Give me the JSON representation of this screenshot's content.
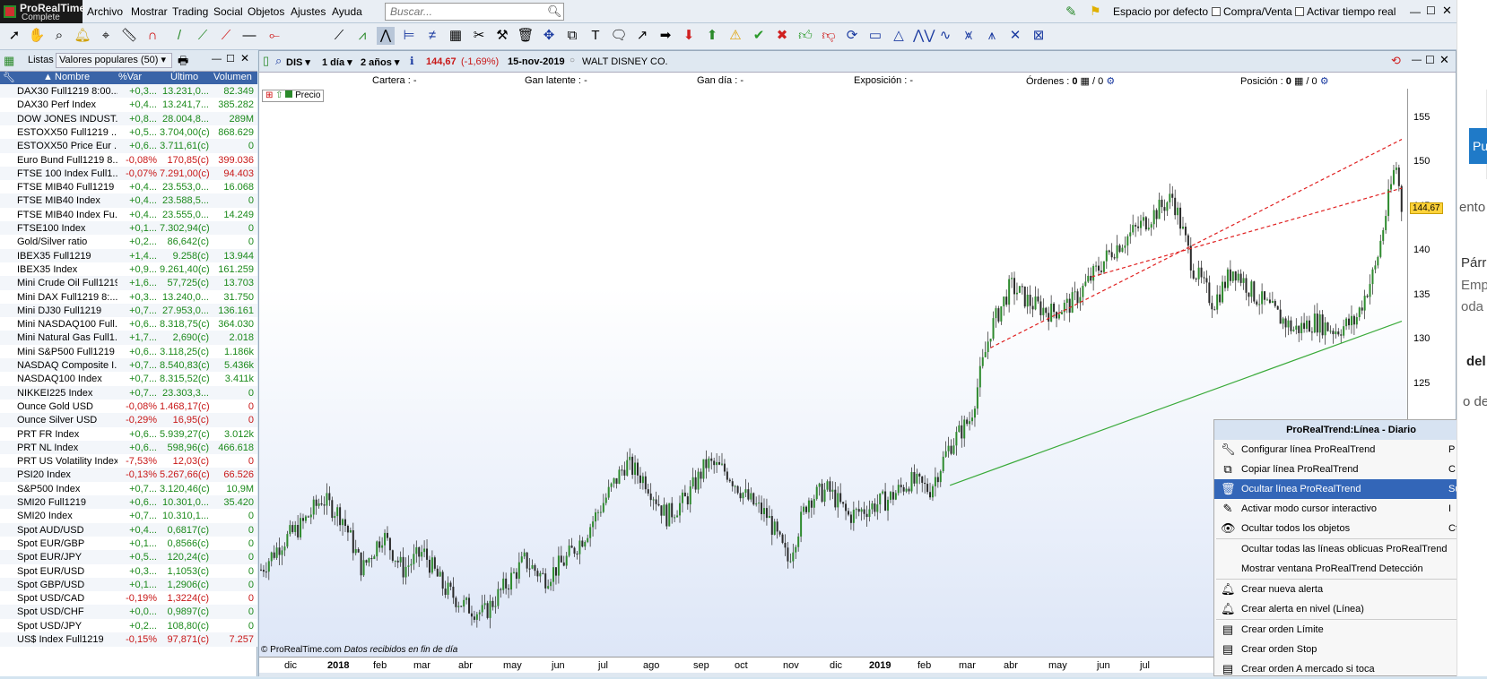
{
  "app": {
    "logo_line1": "ProRealTime",
    "logo_line2": "Complete"
  },
  "menu": [
    "Archivo",
    "Mostrar",
    "Trading",
    "Social",
    "Objetos",
    "Ajustes",
    "Ayuda"
  ],
  "search": {
    "placeholder": "Buscar..."
  },
  "top_right": {
    "workspace": "Espacio por defecto",
    "buy_sell": "Compra/Venta",
    "realtime": "Activar tiempo real"
  },
  "left_panel": {
    "lists_label": "Listas",
    "list_name": "Valores populares (50)",
    "columns": [
      "Nombre",
      "%Var",
      "Último",
      "Volumen"
    ],
    "rows": [
      [
        "DAX30 Full1219 8:00...",
        "+0,3...",
        "13.231,0...",
        "82.349"
      ],
      [
        "DAX30 Perf Index",
        "+0,4...",
        "13.241,7...",
        "385.282"
      ],
      [
        "DOW JONES INDUST...",
        "+0,8...",
        "28.004,8...",
        "289M"
      ],
      [
        "ESTOXX50 Full1219 ...",
        "+0,5...",
        "3.704,00(c)",
        "868.629"
      ],
      [
        "ESTOXX50 Price Eur ...",
        "+0,6...",
        "3.711,61(c)",
        "0"
      ],
      [
        "Euro Bund Full1219 8...",
        "-0,08%",
        "170,85(c)",
        "399.036"
      ],
      [
        "FTSE 100 Index Full1...",
        "-0,07%",
        "7.291,00(c)",
        "94.403"
      ],
      [
        "FTSE MIB40 Full1219",
        "+0,4...",
        "23.553,0...",
        "16.068"
      ],
      [
        "FTSE MIB40 Index",
        "+0,4...",
        "23.588,5...",
        "0"
      ],
      [
        "FTSE MIB40 Index Fu...",
        "+0,4...",
        "23.555,0...",
        "14.249"
      ],
      [
        "FTSE100 Index",
        "+0,1...",
        "7.302,94(c)",
        "0"
      ],
      [
        "Gold/Silver ratio",
        "+0,2...",
        "86,642(c)",
        "0"
      ],
      [
        "IBEX35 Full1219",
        "+1,4...",
        "9.258(c)",
        "13.944"
      ],
      [
        "IBEX35 Index",
        "+0,9...",
        "9.261,40(c)",
        "161.259"
      ],
      [
        "Mini Crude Oil Full1219",
        "+1,6...",
        "57,725(c)",
        "13.703"
      ],
      [
        "Mini DAX Full1219 8:...",
        "+0,3...",
        "13.240,0...",
        "31.750"
      ],
      [
        "Mini DJ30 Full1219",
        "+0,7...",
        "27.953,0...",
        "136.161"
      ],
      [
        "Mini NASDAQ100 Full...",
        "+0,6...",
        "8.318,75(c)",
        "364.030"
      ],
      [
        "Mini Natural Gas Full1...",
        "+1,7...",
        "2,690(c)",
        "2.018"
      ],
      [
        "Mini S&P500 Full1219",
        "+0,6...",
        "3.118,25(c)",
        "1.186k"
      ],
      [
        "NASDAQ Composite I...",
        "+0,7...",
        "8.540,83(c)",
        "5.436k"
      ],
      [
        "NASDAQ100 Index",
        "+0,7...",
        "8.315,52(c)",
        "3.411k"
      ],
      [
        "NIKKEI225 Index",
        "+0,7...",
        "23.303,3...",
        "0"
      ],
      [
        "Ounce Gold USD",
        "-0,08%",
        "1.468,17(c)",
        "0"
      ],
      [
        "Ounce Silver USD",
        "-0,29%",
        "16,95(c)",
        "0"
      ],
      [
        "PRT FR Index",
        "+0,6...",
        "5.939,27(c)",
        "3.012k"
      ],
      [
        "PRT NL Index",
        "+0,6...",
        "598,96(c)",
        "466.618"
      ],
      [
        "PRT US Volatility Index",
        "-7,53%",
        "12,03(c)",
        "0"
      ],
      [
        "PSI20 Index",
        "-0,13%",
        "5.267,66(c)",
        "66.526"
      ],
      [
        "S&P500 Index",
        "+0,7...",
        "3.120,46(c)",
        "10,9M"
      ],
      [
        "SMI20 Full1219",
        "+0,6...",
        "10.301,0...",
        "35.420"
      ],
      [
        "SMI20 Index",
        "+0,7...",
        "10.310,1...",
        "0"
      ],
      [
        "Spot AUD/USD",
        "+0,4...",
        "0,6817(c)",
        "0"
      ],
      [
        "Spot EUR/GBP",
        "+0,1...",
        "0,8566(c)",
        "0"
      ],
      [
        "Spot EUR/JPY",
        "+0,5...",
        "120,24(c)",
        "0"
      ],
      [
        "Spot EUR/USD",
        "+0,3...",
        "1,1053(c)",
        "0"
      ],
      [
        "Spot GBP/USD",
        "+0,1...",
        "1,2906(c)",
        "0"
      ],
      [
        "Spot USD/CAD",
        "-0,19%",
        "1,3224(c)",
        "0"
      ],
      [
        "Spot USD/CHF",
        "+0,0...",
        "0,9897(c)",
        "0"
      ],
      [
        "Spot USD/JPY",
        "+0,2...",
        "108,80(c)",
        "0"
      ],
      [
        "US$ Index Full1219",
        "-0,15%",
        "97,871(c)",
        "7.257"
      ]
    ]
  },
  "chart_window": {
    "ticker": "DIS",
    "period": "1 día",
    "range": "2 años",
    "price": "144,67",
    "change": "(-1,69%)",
    "date": "15-nov-2019",
    "name": "WALT DISNEY CO.",
    "info": {
      "cartera": "Cartera :",
      "cartera_val": "-",
      "latente": "Gan latente :",
      "latente_val": "-",
      "gandia": "Gan día :",
      "gandia_val": "-",
      "expo": "Exposición :",
      "expo_val": "-",
      "ordenes": "Órdenes :",
      "ordenes_val": "0",
      "ordenes_val2": "/ 0",
      "posicion": "Posición :",
      "posicion_val": "0",
      "posicion_val2": "/ 0"
    },
    "legend": "Precio",
    "watermark": "© ProRealTime.com",
    "watermark2": "Datos recibidos en fin de día"
  },
  "chart_data": {
    "type": "candlestick",
    "title": "DIS",
    "yticks": [
      120,
      125,
      130,
      135,
      140,
      145,
      150,
      155
    ],
    "ylim": [
      118,
      157
    ],
    "last_price": 144.67,
    "xticks": [
      "dic",
      "2018",
      "feb",
      "mar",
      "abr",
      "may",
      "jun",
      "jul",
      "ago",
      "sep",
      "oct",
      "nov",
      "dic",
      "2019",
      "feb",
      "mar",
      "abr",
      "may",
      "jun",
      "jul"
    ],
    "close_series": [
      [
        0,
        104
      ],
      [
        10,
        107
      ],
      [
        20,
        109
      ],
      [
        30,
        112
      ],
      [
        40,
        110
      ],
      [
        50,
        104
      ],
      [
        60,
        108
      ],
      [
        70,
        104
      ],
      [
        80,
        106
      ],
      [
        90,
        102
      ],
      [
        100,
        100
      ],
      [
        110,
        99
      ],
      [
        120,
        102
      ],
      [
        130,
        105
      ],
      [
        140,
        103
      ],
      [
        150,
        105
      ],
      [
        160,
        108
      ],
      [
        170,
        112
      ],
      [
        180,
        116
      ],
      [
        190,
        114
      ],
      [
        200,
        110
      ],
      [
        210,
        112
      ],
      [
        220,
        116
      ],
      [
        230,
        115
      ],
      [
        240,
        112
      ],
      [
        250,
        110
      ],
      [
        260,
        105
      ],
      [
        270,
        112
      ],
      [
        280,
        113
      ],
      [
        290,
        110
      ],
      [
        300,
        111
      ],
      [
        310,
        112
      ],
      [
        320,
        114
      ],
      [
        330,
        113
      ],
      [
        340,
        118
      ],
      [
        350,
        121
      ],
      [
        360,
        131
      ],
      [
        370,
        136
      ],
      [
        380,
        134
      ],
      [
        390,
        133
      ],
      [
        400,
        134
      ],
      [
        410,
        137
      ],
      [
        420,
        140
      ],
      [
        430,
        142
      ],
      [
        440,
        144
      ],
      [
        450,
        146
      ],
      [
        460,
        138
      ],
      [
        470,
        134
      ],
      [
        480,
        138
      ],
      [
        490,
        135
      ],
      [
        500,
        133
      ],
      [
        510,
        131
      ],
      [
        520,
        132
      ],
      [
        530,
        131
      ],
      [
        540,
        132
      ],
      [
        550,
        138
      ],
      [
        560,
        150
      ],
      [
        563,
        144.67
      ]
    ],
    "trendlines": [
      {
        "kind": "support",
        "color": "#3aaa3a",
        "from": [
          340,
          113.5
        ],
        "to": [
          563,
          132
        ]
      },
      {
        "kind": "channel-top",
        "color": "#e02020",
        "from": [
          360,
          129
        ],
        "to": [
          563,
          152.5
        ]
      },
      {
        "kind": "channel-mid",
        "color": "#e02020",
        "from": [
          410,
          137
        ],
        "to": [
          563,
          147
        ]
      }
    ]
  },
  "context_menu": {
    "title": "ProRealTrend:Línea - Diario",
    "items": [
      {
        "label": "Configurar línea ProRealTrend",
        "shortcut": "P",
        "icon": "wrench-icon"
      },
      {
        "label": "Copiar línea ProRealTrend",
        "shortcut": "C",
        "icon": "copy-icon"
      },
      {
        "label": "Ocultar línea ProRealTrend",
        "shortcut": "Suprimir",
        "icon": "trash-icon",
        "highlight": true
      },
      {
        "label": "Activar modo cursor interactivo",
        "shortcut": "I",
        "icon": "cursor-icon"
      },
      {
        "label": "Ocultar todos los objetos",
        "shortcut": "Ctrl+J",
        "icon": "eye-icon"
      },
      {
        "label": "Ocultar todas las líneas oblicuas ProRealTrend",
        "shortcut": "",
        "icon": ""
      },
      {
        "label": "Mostrar ventana ProRealTrend Detección",
        "shortcut": "",
        "icon": ""
      },
      {
        "label": "Crear nueva alerta",
        "shortcut": "",
        "icon": "bell-icon"
      },
      {
        "label": "Crear alerta en nivel (Línea)",
        "shortcut": "",
        "icon": "bell-line-icon"
      },
      {
        "label": "Crear orden Límite",
        "shortcut": "",
        "icon": "order-icon"
      },
      {
        "label": "Crear orden Stop",
        "shortcut": "",
        "icon": "order-icon"
      },
      {
        "label": "Crear orden A mercado si toca",
        "shortcut": "",
        "icon": "order-icon"
      }
    ]
  },
  "right_peek": {
    "a": "Pu",
    "b": "ento",
    "c": "Párra",
    "d": "Empie",
    "e": "oda l",
    "f": "del t",
    "g": "o de l"
  }
}
